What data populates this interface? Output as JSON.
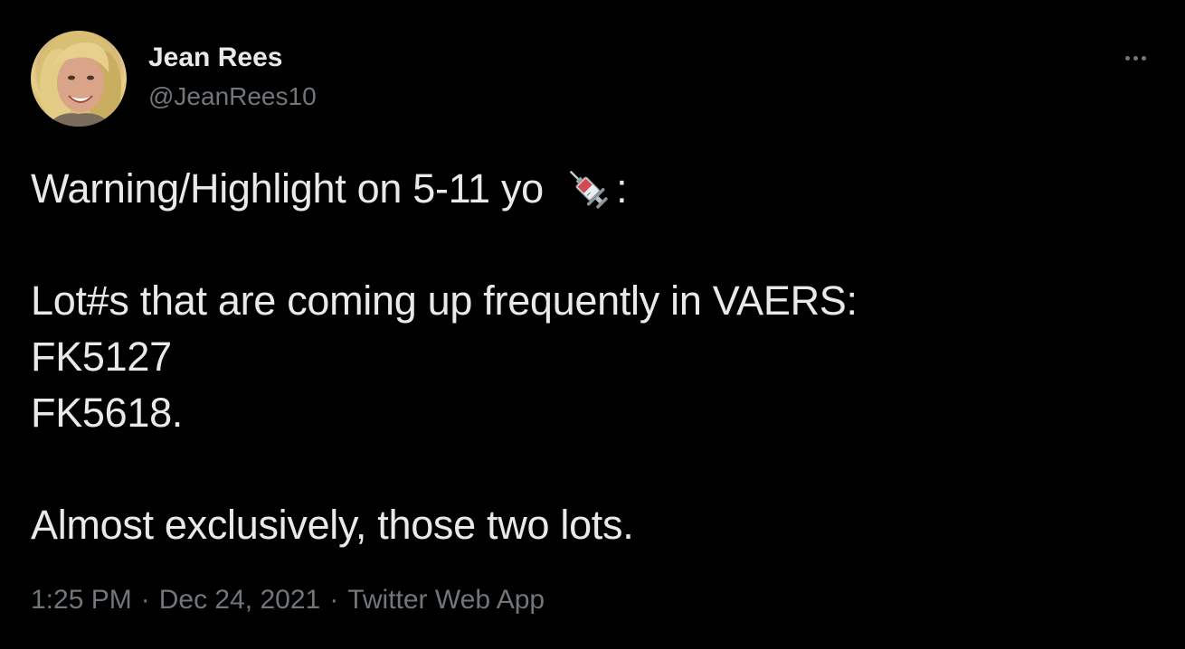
{
  "author": {
    "display_name": "Jean Rees",
    "handle": "@JeanRees10",
    "avatar_icon": "user-avatar-photo"
  },
  "more_icon": "more-horizontal-icon",
  "tweet": {
    "line1_before_emoji": "Warning/Highlight on 5-11 yo ",
    "emoji_icon": "syringe-icon",
    "line1_after_emoji": ":",
    "line2": "Lot#s that are coming up frequently in VAERS:",
    "line3": "FK5127",
    "line4": "FK5618.",
    "line5": "Almost exclusively, those two lots."
  },
  "meta": {
    "time": "1:25 PM",
    "separator": "·",
    "date": "Dec 24, 2021",
    "source": "Twitter Web App"
  },
  "colors": {
    "background": "#000000",
    "primary_text": "#e7e9ea",
    "secondary_text": "#71767b"
  }
}
